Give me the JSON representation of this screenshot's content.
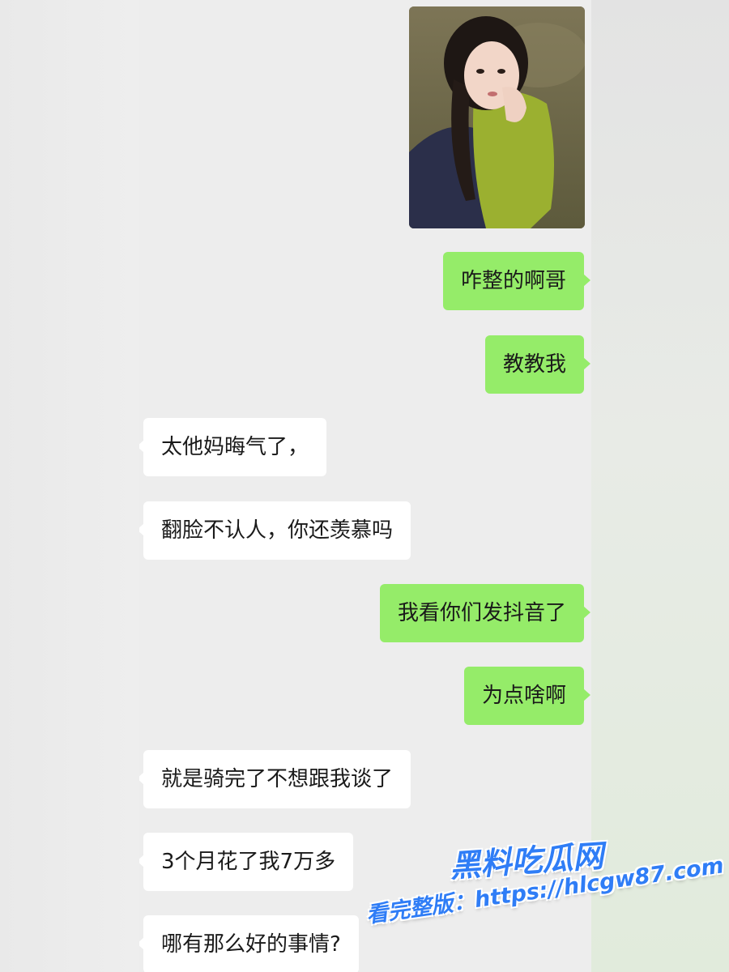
{
  "conversation": {
    "photo_description_icon": "selfie-photo",
    "messages": [
      {
        "side": "out",
        "text": "咋整的啊哥"
      },
      {
        "side": "out",
        "text": "教教我"
      },
      {
        "side": "in",
        "text": "太他妈晦气了，"
      },
      {
        "side": "in",
        "text": "翻脸不认人，你还羡慕吗"
      },
      {
        "side": "out",
        "text": "我看你们发抖音了"
      },
      {
        "side": "out",
        "text": "为点啥啊"
      },
      {
        "side": "in",
        "text": "就是骑完了不想跟我谈了"
      },
      {
        "side": "in",
        "text": "3个月花了我7万多"
      },
      {
        "side": "in",
        "text": "哪有那么好的事情?"
      }
    ]
  },
  "watermark": {
    "site_name": "黑料吃瓜网",
    "full_version_text": "看完整版：https://hlcgw87.com"
  },
  "colors": {
    "outgoing_bubble": "#95ec69",
    "incoming_bubble": "#ffffff",
    "chat_background": "#ededed",
    "watermark": "#2f7df6"
  }
}
